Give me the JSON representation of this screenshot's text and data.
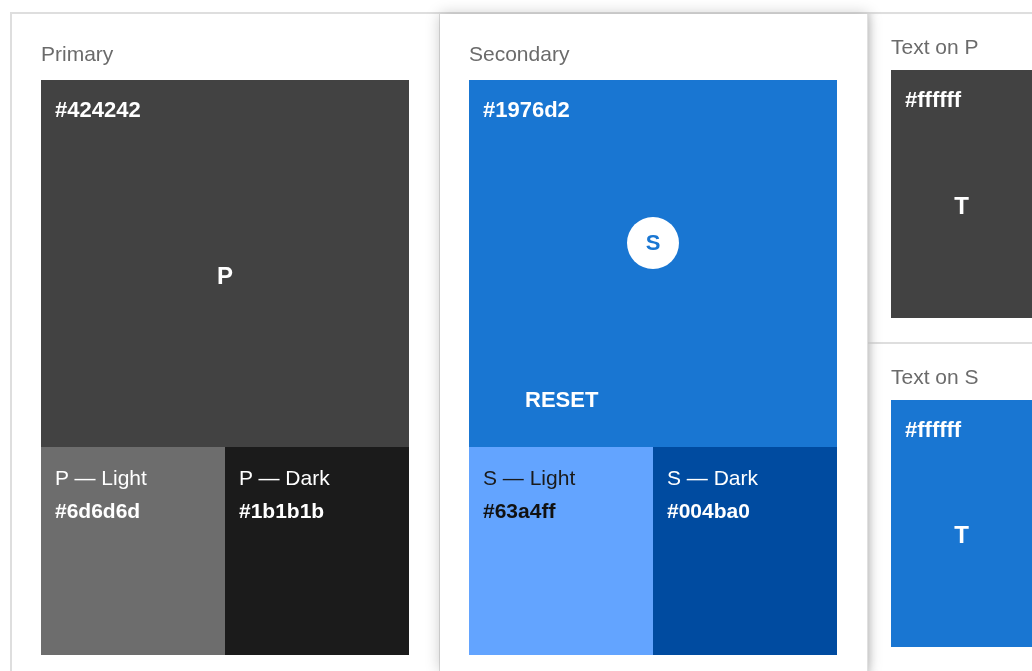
{
  "palettes": [
    {
      "title": "Primary",
      "main": {
        "hex": "#424242",
        "color": "#424242",
        "letter": "P",
        "kind": "plain"
      },
      "variants": [
        {
          "label": "P — Light",
          "hex": "#6d6d6d",
          "color": "#6d6d6d",
          "dark_text": false
        },
        {
          "label": "P — Dark",
          "hex": "#1b1b1b",
          "color": "#1b1b1b",
          "dark_text": false
        }
      ],
      "raised": false
    },
    {
      "title": "Secondary",
      "main": {
        "hex": "#1976d2",
        "color": "#1976d2",
        "letter": "S",
        "kind": "circle",
        "button": "RESET"
      },
      "variants": [
        {
          "label": "S — Light",
          "hex": "#63a4ff",
          "color": "#63a4ff",
          "dark_text": true
        },
        {
          "label": "S — Dark",
          "hex": "#004ba0",
          "color": "#004ba0",
          "dark_text": false
        }
      ],
      "raised": true
    }
  ],
  "text_cards": [
    {
      "title": "Text on P",
      "hex": "#ffffff",
      "color": "#424242",
      "letter": "T"
    },
    {
      "title": "Text on S",
      "hex": "#ffffff",
      "color": "#1976d2",
      "letter": "T"
    }
  ]
}
